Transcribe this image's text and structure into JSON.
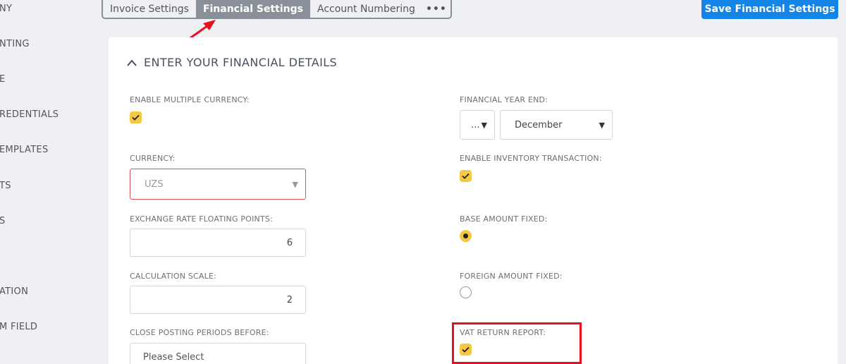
{
  "sidebar": {
    "items": [
      {
        "label": "NY"
      },
      {
        "label": "NTING"
      },
      {
        "label": "E"
      },
      {
        "label": "REDENTIALS"
      },
      {
        "label": "EMPLATES"
      },
      {
        "label": "TS"
      },
      {
        "label": "S"
      },
      {
        "label": "ATION"
      },
      {
        "label": "M FIELD"
      }
    ]
  },
  "tabs": [
    {
      "label": "Invoice Settings"
    },
    {
      "label": "Financial Settings"
    },
    {
      "label": "Account Numbering"
    },
    {
      "label": "•••"
    }
  ],
  "toolbar": {
    "save_label": "Save Financial Settings"
  },
  "section": {
    "title": "ENTER YOUR FINANCIAL DETAILS"
  },
  "form": {
    "enable_multiple_currency": {
      "label": "ENABLE MULTIPLE CURRENCY:",
      "checked": true
    },
    "currency": {
      "label": "CURRENCY:",
      "value": "UZS"
    },
    "exchange_rate_floating_points": {
      "label": "EXCHANGE RATE FLOATING POINTS:",
      "value": "6"
    },
    "calculation_scale": {
      "label": "CALCULATION SCALE:",
      "value": "2"
    },
    "close_posting_periods_before": {
      "label": "CLOSE POSTING PERIODS BEFORE:",
      "placeholder": "Please Select"
    },
    "financial_year_end": {
      "label": "FINANCIAL YEAR END:",
      "day_value": "...",
      "month_value": "December"
    },
    "enable_inventory_transaction": {
      "label": "ENABLE INVENTORY TRANSACTION:",
      "checked": true
    },
    "base_amount_fixed": {
      "label": "BASE AMOUNT FIXED:",
      "selected": true
    },
    "foreign_amount_fixed": {
      "label": "FOREIGN AMOUNT FIXED:",
      "selected": false
    },
    "vat_return_report": {
      "label": "VAT RETURN REPORT:",
      "checked": true
    }
  },
  "annotations": {
    "arrow_color": "#e8101c",
    "box_color": "#e8101c"
  },
  "colors": {
    "accent": "#1484e6",
    "check": "#f5c842",
    "tab_active": "#8a9099"
  }
}
